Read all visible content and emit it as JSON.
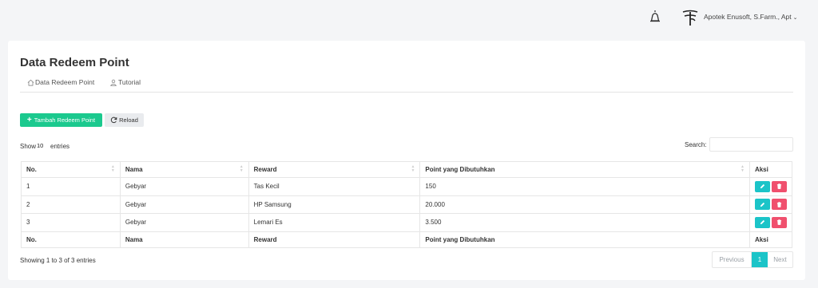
{
  "header": {
    "user_name": "Apotek Enusoft, S.Farm., Apt",
    "caret": "⌄"
  },
  "page": {
    "title": "Data Redeem Point",
    "tabs": [
      {
        "label": "Data Redeem Point",
        "icon": "home-icon"
      },
      {
        "label": "Tutorial",
        "icon": "user-icon"
      }
    ]
  },
  "toolbar": {
    "add_label": "Tambah Redeem Point",
    "reload_label": "Reload"
  },
  "table_controls": {
    "show_label": "Show",
    "show_value": "10",
    "entries_label": "entries",
    "search_label": "Search:",
    "search_value": ""
  },
  "table": {
    "columns": [
      "No.",
      "Nama",
      "Reward",
      "Point yang Dibutuhkan",
      "Aksi"
    ],
    "rows": [
      {
        "no": "1",
        "nama": "Gebyar",
        "reward": "Tas Kecil",
        "point": "150"
      },
      {
        "no": "2",
        "nama": "Gebyar",
        "reward": "HP Samsung",
        "point": "20.000"
      },
      {
        "no": "3",
        "nama": "Gebyar",
        "reward": "Lemari Es",
        "point": "3.500"
      }
    ]
  },
  "footer": {
    "info": "Showing 1 to 3 of 3 entries",
    "prev_label": "Previous",
    "current_page": "1",
    "next_label": "Next"
  },
  "colors": {
    "accent_green": "#1bc98e",
    "accent_teal": "#1bc4c8",
    "danger": "#f0506e"
  }
}
